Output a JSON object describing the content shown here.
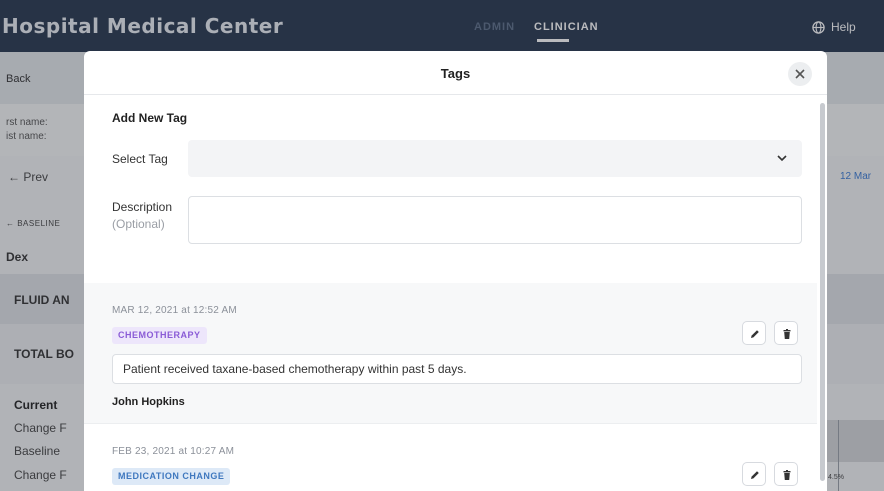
{
  "app": {
    "title": "Hospital Medical Center",
    "nav": {
      "admin": "ADMIN",
      "clinician": "CLINICIAN",
      "help": "Help"
    }
  },
  "background": {
    "back": "Back",
    "first_name": "rst name:",
    "last_name": "ist name:",
    "prev": "← Prev",
    "date": "12 Mar",
    "baseline_link": "← BASELINE",
    "dex": "Dex",
    "fluid": "FLUID AN",
    "total": "TOTAL BO",
    "current": "Current",
    "change1": "Change F",
    "baseline": "Baseline",
    "change2": "Change F",
    "pct": "4.5%"
  },
  "modal": {
    "title": "Tags",
    "close_icon": "close-icon",
    "add_new_tag": "Add New Tag",
    "select_tag_label": "Select Tag",
    "select_tag_value": "",
    "description_label": "Description",
    "description_optional": "(Optional)",
    "description_value": ""
  },
  "tags": [
    {
      "date": "MAR 12, 2021 at 12:52 AM",
      "label": "CHEMOTHERAPY",
      "color": "#8a5bd6",
      "description": "Patient received taxane-based chemotherapy within past 5 days.",
      "author": "John Hopkins"
    },
    {
      "date": "FEB 23, 2021 at 10:27 AM",
      "label": "MEDICATION CHANGE",
      "color": "#3f78bf"
    }
  ]
}
